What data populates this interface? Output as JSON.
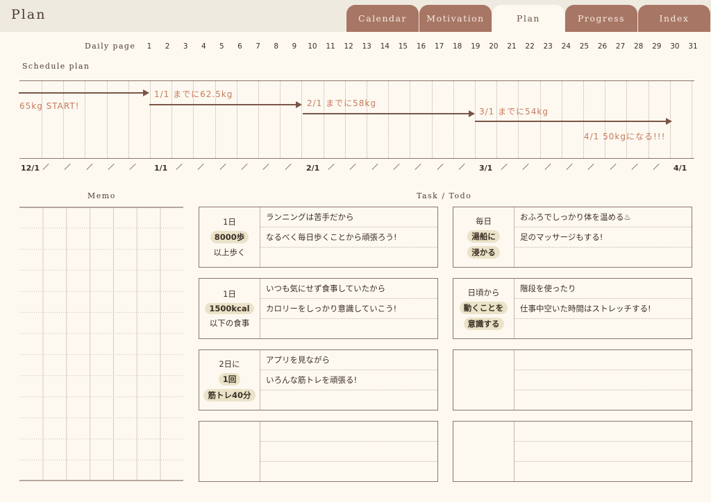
{
  "header": {
    "title": "Plan",
    "tabs": [
      {
        "label": "Calendar",
        "active": false
      },
      {
        "label": "Motivation",
        "active": false
      },
      {
        "label": "Plan",
        "active": true
      },
      {
        "label": "Progress",
        "active": false
      },
      {
        "label": "Index",
        "active": false
      }
    ]
  },
  "daily_page": {
    "label": "Daily page",
    "days": [
      "1",
      "2",
      "3",
      "4",
      "5",
      "6",
      "7",
      "8",
      "9",
      "10",
      "11",
      "12",
      "13",
      "14",
      "15",
      "16",
      "17",
      "18",
      "19",
      "20",
      "21",
      "22",
      "23",
      "24",
      "25",
      "26",
      "27",
      "28",
      "29",
      "30",
      "31"
    ]
  },
  "schedule": {
    "label": "Schedule plan",
    "milestones": [
      {
        "text": "65kg START!"
      },
      {
        "text": "1/1 までに62.5kg"
      },
      {
        "text": "2/1 までに58kg"
      },
      {
        "text": "3/1 までに54kg"
      },
      {
        "text": "4/1 50kgになる!!!"
      }
    ],
    "dates": [
      "12/1",
      "1/1",
      "2/1",
      "3/1",
      "4/1"
    ]
  },
  "memo": {
    "title": "Memo"
  },
  "tasks": {
    "title": "Task / Todo",
    "cards": [
      {
        "left": [
          "1日",
          "8000歩",
          "以上歩く"
        ],
        "rows": [
          "ランニングは苦手だから",
          "なるべく毎日歩くことから頑張ろう!",
          ""
        ]
      },
      {
        "left": [
          "毎日",
          "湯船に",
          "浸かる"
        ],
        "rows": [
          "おふろでしっかり体を温める♨",
          "足のマッサージもする!",
          ""
        ]
      },
      {
        "left": [
          "1日",
          "1500kcal",
          "以下の食事"
        ],
        "rows": [
          "いつも気にせず食事していたから",
          "カロリーをしっかり意識していこう!",
          ""
        ]
      },
      {
        "left": [
          "日頃から",
          "動くことを",
          "意識する"
        ],
        "rows": [
          "階段を使ったり",
          "仕事中空いた時間はストレッチする!",
          ""
        ]
      },
      {
        "left": [
          "2日に",
          "1回",
          "筋トレ40分"
        ],
        "rows": [
          "アプリを見ながら",
          "いろんな筋トレを頑張る!",
          ""
        ]
      },
      {
        "left": [
          "",
          "",
          ""
        ],
        "rows": [
          "",
          "",
          ""
        ]
      },
      {
        "left": [
          "",
          "",
          ""
        ],
        "rows": [
          "",
          "",
          ""
        ]
      },
      {
        "left": [
          "",
          "",
          ""
        ],
        "rows": [
          "",
          "",
          ""
        ]
      }
    ]
  },
  "colors": {
    "background": "#fdf9f1",
    "tab": "#a77664",
    "accent_text": "#c67a5c",
    "highlight": "#eae3c8"
  }
}
